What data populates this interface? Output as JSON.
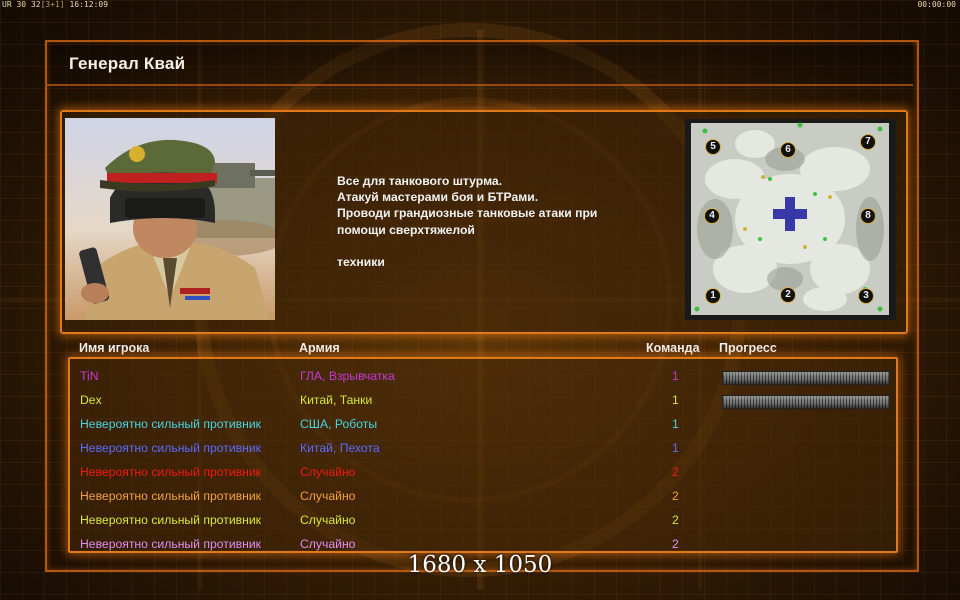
{
  "hud": {
    "left_prefix": "UR",
    "left_a": "30",
    "left_b": "32",
    "left_c": "[3+1]",
    "clock": "16:12:09",
    "timer": "00:00:00"
  },
  "general": {
    "title": "Генерал Квай",
    "description": "Все для танкового штурма.\nАтакуй мастерами боя и БТРами.\nПроводи грандиозные танковые атаки при\n помощи сверхтяжелой\n\nтехники"
  },
  "map": {
    "start_positions": [
      "1",
      "2",
      "3",
      "4",
      "5",
      "6",
      "7",
      "8"
    ]
  },
  "table": {
    "headers": {
      "name": "Имя игрока",
      "army": "Армия",
      "team": "Команда",
      "progress": "Прогресс"
    },
    "rows": [
      {
        "name": "TiN",
        "army": "ГЛА, Взрывчатка",
        "team": "1",
        "color": "#c239d4",
        "progress": 1.0
      },
      {
        "name": "Dex",
        "army": "Китай, Танки",
        "team": "1",
        "color": "#d6e83c",
        "progress": 1.0
      },
      {
        "name": "Невероятно сильный противник",
        "army": "США, Роботы",
        "team": "1",
        "color": "#48d4e0",
        "progress": null
      },
      {
        "name": "Невероятно сильный противник",
        "army": "Китай, Пехота",
        "team": "1",
        "color": "#5a6bff",
        "progress": null
      },
      {
        "name": "Невероятно сильный противник",
        "army": "Случайно",
        "team": "2",
        "color": "#f01a10",
        "progress": null
      },
      {
        "name": "Невероятно сильный противник",
        "army": "Случайно",
        "team": "2",
        "color": "#f0a040",
        "progress": null
      },
      {
        "name": "Невероятно сильный противник",
        "army": "Случайно",
        "team": "2",
        "color": "#d6e83c",
        "progress": null
      },
      {
        "name": "Невероятно сильный противник",
        "army": "Случайно",
        "team": "2",
        "color": "#e08ef0",
        "progress": null
      }
    ]
  },
  "overlay": {
    "resolution": "1680 x 1050"
  }
}
